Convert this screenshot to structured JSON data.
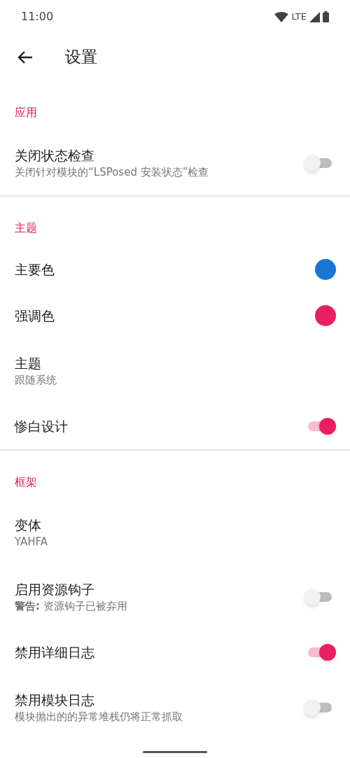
{
  "status_bar": {
    "time": "11:00",
    "network": "LTE"
  },
  "toolbar": {
    "title": "设置"
  },
  "sections": [
    {
      "header": "应用",
      "items": [
        {
          "kind": "switch",
          "title": "关闭状态检查",
          "summary": "关闭针对模块的“LSPosed 安装状态”检查",
          "on": false
        }
      ]
    },
    {
      "header": "主题",
      "items": [
        {
          "kind": "color",
          "title": "主要色",
          "color": "#1976d2"
        },
        {
          "kind": "color",
          "title": "强调色",
          "color": "#e91e63"
        },
        {
          "kind": "text",
          "title": "主题",
          "summary": "跟随系统"
        },
        {
          "kind": "switch",
          "title": "惨白设计",
          "on": true
        }
      ]
    },
    {
      "header": "框架",
      "items": [
        {
          "kind": "text",
          "title": "变体",
          "summary": "YAHFA"
        },
        {
          "kind": "switch",
          "title": "启用资源钩子",
          "summary": "**警告:** 资源钩子已被弃用",
          "on": false
        },
        {
          "kind": "switch",
          "title": "禁用详细日志",
          "on": true
        },
        {
          "kind": "switch",
          "title": "禁用模块日志",
          "summary": "模块抛出的的异常堆栈仍将正常抓取",
          "on": false
        }
      ]
    }
  ]
}
